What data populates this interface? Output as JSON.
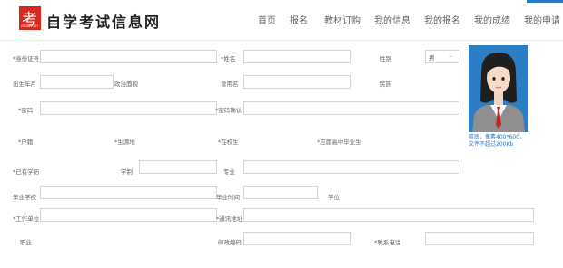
{
  "logo": {
    "glyph": "考",
    "mini": "zikaoe.cn",
    "text": "自学考试信息网"
  },
  "nav": [
    "首页",
    "报名",
    "教材订购",
    "我的信息",
    "我的报名",
    "我的成绩",
    "我的申请"
  ],
  "form": {
    "id_label": "*身份证号",
    "name_label": "*姓名",
    "gender_label": "性别",
    "gender_value": "男",
    "birth_label": "出生年月",
    "political_label": "政治面貌",
    "former_name_label": "曾用名",
    "ethnicity_label": "民族",
    "password_label": "*密码",
    "password_confirm_label": "*密码确认",
    "hukou_label": "*户籍",
    "source_label": "*生源地",
    "student_label": "*在校生",
    "highschool_grad_label": "*应届高中毕业生",
    "education_label": "*已有学历",
    "degree_label": "学制",
    "major_label": "专业",
    "school_label": "毕业学校",
    "grad_date_label": "毕业时间",
    "academic_degree_label": "学位",
    "employer_label": "*工作单位",
    "address_label": "*通讯地址",
    "occupation_label": "职业",
    "postcode_label": "邮政编码",
    "phone_label": "*联系电话"
  },
  "photo": {
    "note_line1": "蓝底，像素400*600，",
    "note_line2": "文件不超过200Kb"
  },
  "colors": {
    "brand_red": "#d62a1e",
    "link_blue": "#2b79c2",
    "photo_bg": "#2c7cc6"
  }
}
